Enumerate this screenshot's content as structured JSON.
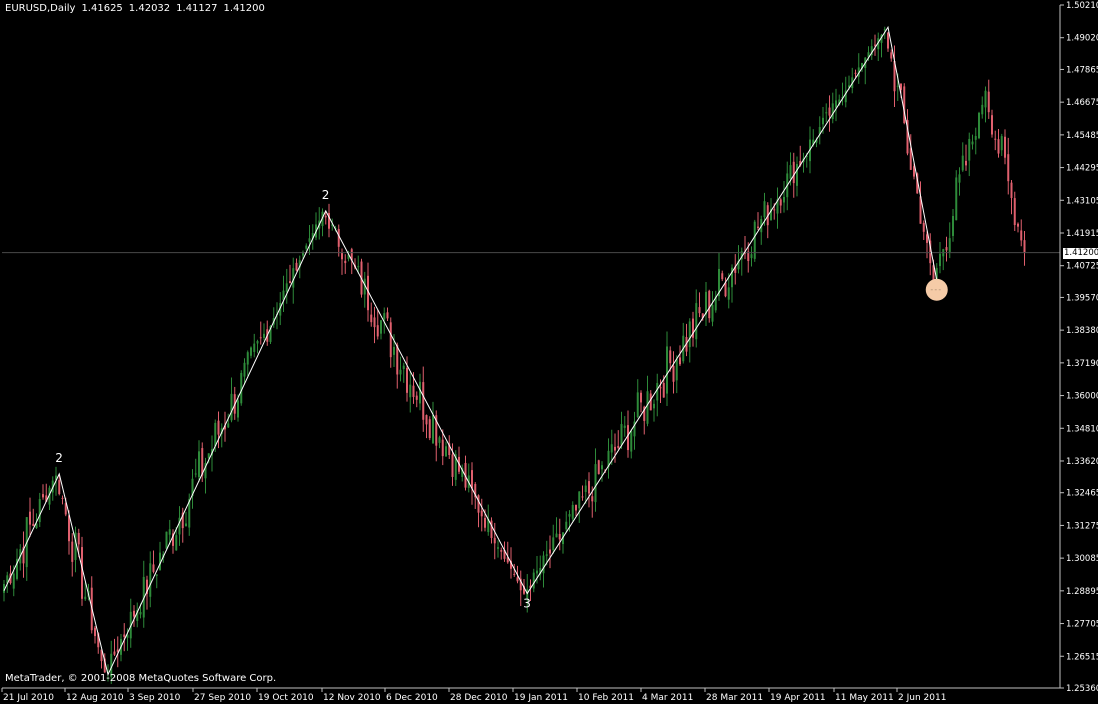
{
  "header": {
    "symbol": "EURUSD,Daily",
    "open": "1.41625",
    "high": "1.42032",
    "low": "1.41127",
    "close": "1.41200"
  },
  "copyright": "MetaTrader, © 2001-2008 MetaQuotes Software Corp.",
  "current_price_label": "1.41200",
  "colors": {
    "background": "#000000",
    "axis": "#c0c0c0",
    "bull": "#2e8b3a",
    "bear": "#e0606e",
    "zigzag": "#ffffff",
    "marker": "#f5cba7"
  },
  "chart_data": {
    "type": "candlestick",
    "instrument": "EURUSD",
    "timeframe": "Daily",
    "ylim": [
      1.2536,
      1.5021
    ],
    "y_ticks": [
      "1.50210",
      "1.49020",
      "1.47865",
      "1.46675",
      "1.45485",
      "1.44295",
      "1.43105",
      "1.41915",
      "1.40725",
      "1.39570",
      "1.38380",
      "1.37190",
      "1.36000",
      "1.34810",
      "1.33620",
      "1.32465",
      "1.31275",
      "1.30085",
      "1.28895",
      "1.27705",
      "1.26515",
      "1.25360"
    ],
    "x_ticks": [
      "21 Jul 2010",
      "12 Aug 2010",
      "3 Sep 2010",
      "27 Sep 2010",
      "19 Oct 2010",
      "12 Nov 2010",
      "6 Dec 2010",
      "28 Dec 2010",
      "19 Jan 2011",
      "10 Feb 2011",
      "4 Mar 2011",
      "28 Mar 2011",
      "19 Apr 2011",
      "11 May 2011",
      "2 Jun 2011"
    ],
    "current_price": 1.412,
    "zigzag": [
      {
        "bar": 0,
        "price": 1.289
      },
      {
        "bar": 17,
        "price": 1.3315,
        "label": "2"
      },
      {
        "bar": 32,
        "price": 1.2585
      },
      {
        "bar": 99,
        "price": 1.4272,
        "label": "2"
      },
      {
        "bar": 161,
        "price": 1.288,
        "label": "3"
      },
      {
        "bar": 272,
        "price": 1.494
      },
      {
        "bar": 287,
        "price": 1.402
      }
    ],
    "segments": [
      {
        "bars": 17,
        "from": 1.289,
        "to": 1.3315
      },
      {
        "bars": 15,
        "from": 1.3315,
        "to": 1.2585
      },
      {
        "bars": 67,
        "from": 1.2585,
        "to": 1.4272
      },
      {
        "bars": 62,
        "from": 1.4272,
        "to": 1.288
      },
      {
        "bars": 111,
        "from": 1.288,
        "to": 1.494
      },
      {
        "bars": 15,
        "from": 1.494,
        "to": 1.402
      },
      {
        "bars": 16,
        "from": 1.402,
        "to": 1.47
      },
      {
        "bars": 12,
        "from": 1.47,
        "to": 1.412
      }
    ],
    "marker": {
      "bar": 287,
      "price": 1.3985
    },
    "grid": false
  }
}
